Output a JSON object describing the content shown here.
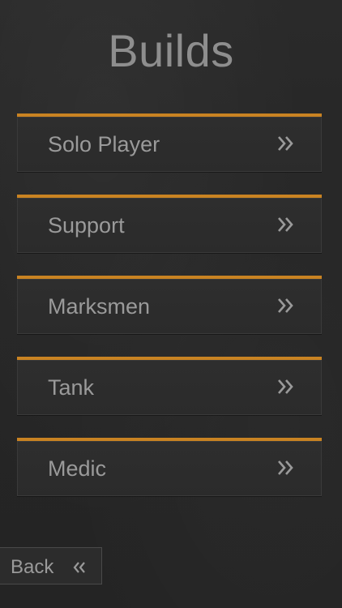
{
  "screen": {
    "title": "Builds"
  },
  "builds": [
    {
      "label": "Solo Player",
      "icon": "double-chevron-right-icon"
    },
    {
      "label": "Support",
      "icon": "double-chevron-right-icon"
    },
    {
      "label": "Marksmen",
      "icon": "double-chevron-right-icon"
    },
    {
      "label": "Tank",
      "icon": "double-chevron-right-icon"
    },
    {
      "label": "Medic",
      "icon": "double-chevron-right-icon"
    }
  ],
  "footer": {
    "back_label": "Back",
    "back_icon": "double-chevron-left-icon"
  },
  "colors": {
    "accent": "#c98322",
    "text": "#9a9a9a",
    "title": "#8e8e8e",
    "background": "#262626"
  }
}
